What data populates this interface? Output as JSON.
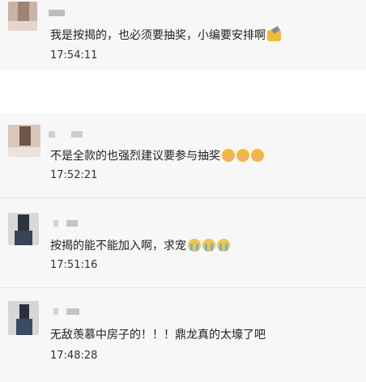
{
  "comments": [
    {
      "message": "我是按揭的，也必须要抽奖，小编要安排啊",
      "emoji": [
        "hammer-emoji"
      ],
      "time": "17:54:11"
    },
    {
      "message": "不是全款的也强烈建议要参与抽奖",
      "emoji": [
        "shy-emoji",
        "shy-emoji",
        "shy-emoji"
      ],
      "time": "17:52:21"
    },
    {
      "message": "按揭的能不能加入啊，求宠",
      "emoji": [
        "cry-emoji",
        "cry-emoji",
        "cry-emoji"
      ],
      "time": "17:51:16"
    },
    {
      "message": "无敌羡慕中房子的！！！鼎龙真的太壕了吧",
      "emoji": [],
      "time": "17:48:28"
    }
  ],
  "colors": {
    "card_bg": "#f7f7f7",
    "separator": "#e2e2e2",
    "text": "#1f1f1f",
    "timestamp": "#333333"
  }
}
